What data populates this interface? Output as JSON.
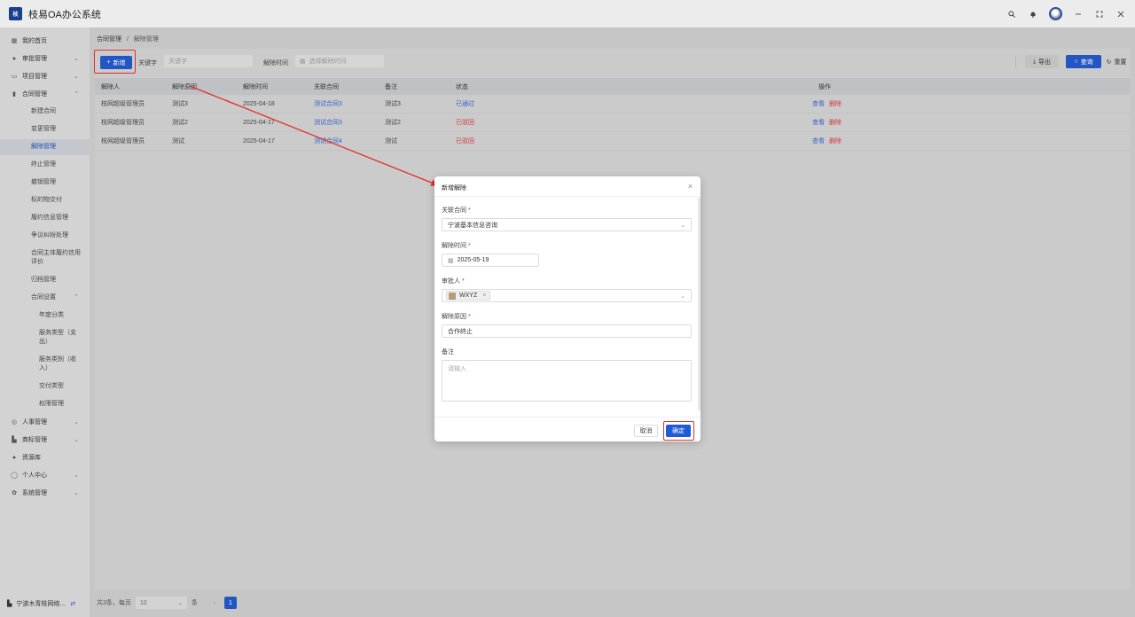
{
  "app": {
    "title": "枝易OA办公系统",
    "logo_text": "枝"
  },
  "sidebar": {
    "items": [
      {
        "label": "我的首页",
        "icon": "grid-icon"
      },
      {
        "label": "审批管理",
        "icon": "user-icon"
      },
      {
        "label": "项目管理",
        "icon": "folder-icon"
      },
      {
        "label": "合同管理",
        "icon": "bar-chart-icon"
      }
    ],
    "contract_sub": [
      "新建合同",
      "变更管理",
      "解除管理",
      "终止管理",
      "撤销管理",
      "标的物交付",
      "履约信息管理",
      "争议纠纷处理",
      "合同主体履约信用评价",
      "归档管理",
      "合同设置"
    ],
    "settings_sub": [
      "年度分类",
      "服务类型（支出）",
      "服务类别（收入）",
      "交付类型",
      "权限管理"
    ],
    "bottom_items": [
      {
        "label": "人事管理",
        "icon": "check-circle-icon"
      },
      {
        "label": "商标管理",
        "icon": "factory-icon"
      },
      {
        "label": "资源库",
        "icon": "pin-icon"
      },
      {
        "label": "个人中心",
        "icon": "person-icon"
      },
      {
        "label": "系统管理",
        "icon": "gear-icon"
      }
    ],
    "org": "宁波木青枝网络..."
  },
  "breadcrumb": {
    "parent": "合同管理",
    "sep": "/",
    "current": "解除管理"
  },
  "toolbar": {
    "new_label": "新增",
    "keyword_label": "关键字",
    "keyword_placeholder": "关键字",
    "time_label": "解除时间",
    "time_placeholder": "选择解除时间",
    "export_label": "导出",
    "query_label": "查询",
    "reset_label": "重置"
  },
  "table": {
    "headers": [
      "解除人",
      "解除原因",
      "解除时间",
      "关联合同",
      "备注",
      "状态",
      "操作"
    ],
    "rows": [
      {
        "person": "枝网超级管理员",
        "reason": "测试3",
        "time": "2025-04-18",
        "contract": "测试合同3",
        "note": "测试3",
        "status": "已通过",
        "view": "查看",
        "delete": "删除"
      },
      {
        "person": "枝网超级管理员",
        "reason": "测试2",
        "time": "2025-04-17",
        "contract": "测试合同3",
        "note": "测试2",
        "status": "已驳回",
        "view": "查看",
        "delete": "删除"
      },
      {
        "person": "枝网超级管理员",
        "reason": "测试",
        "time": "2025-04-17",
        "contract": "测试合同4",
        "note": "测试",
        "status": "已驳回",
        "view": "查看",
        "delete": "删除"
      }
    ]
  },
  "pagination": {
    "total_text": "共3条，每页",
    "page_size": "10",
    "unit": "条",
    "current_page": "1"
  },
  "modal": {
    "title": "新增解除",
    "contract_label": "关联合同",
    "contract_value": "宁波基本信息咨询",
    "time_label": "解除时间",
    "time_value": "2025-05-19",
    "approver_label": "审批人",
    "approver_tag": "WXYZ",
    "reason_label": "解除原因",
    "reason_value": "合作终止",
    "note_label": "备注",
    "note_placeholder": "请输入",
    "cancel_label": "取消",
    "ok_label": "确定",
    "required_mark": "*"
  },
  "colors": {
    "primary": "#2356c2",
    "danger": "#d2373a",
    "highlight": "#e0302a"
  }
}
